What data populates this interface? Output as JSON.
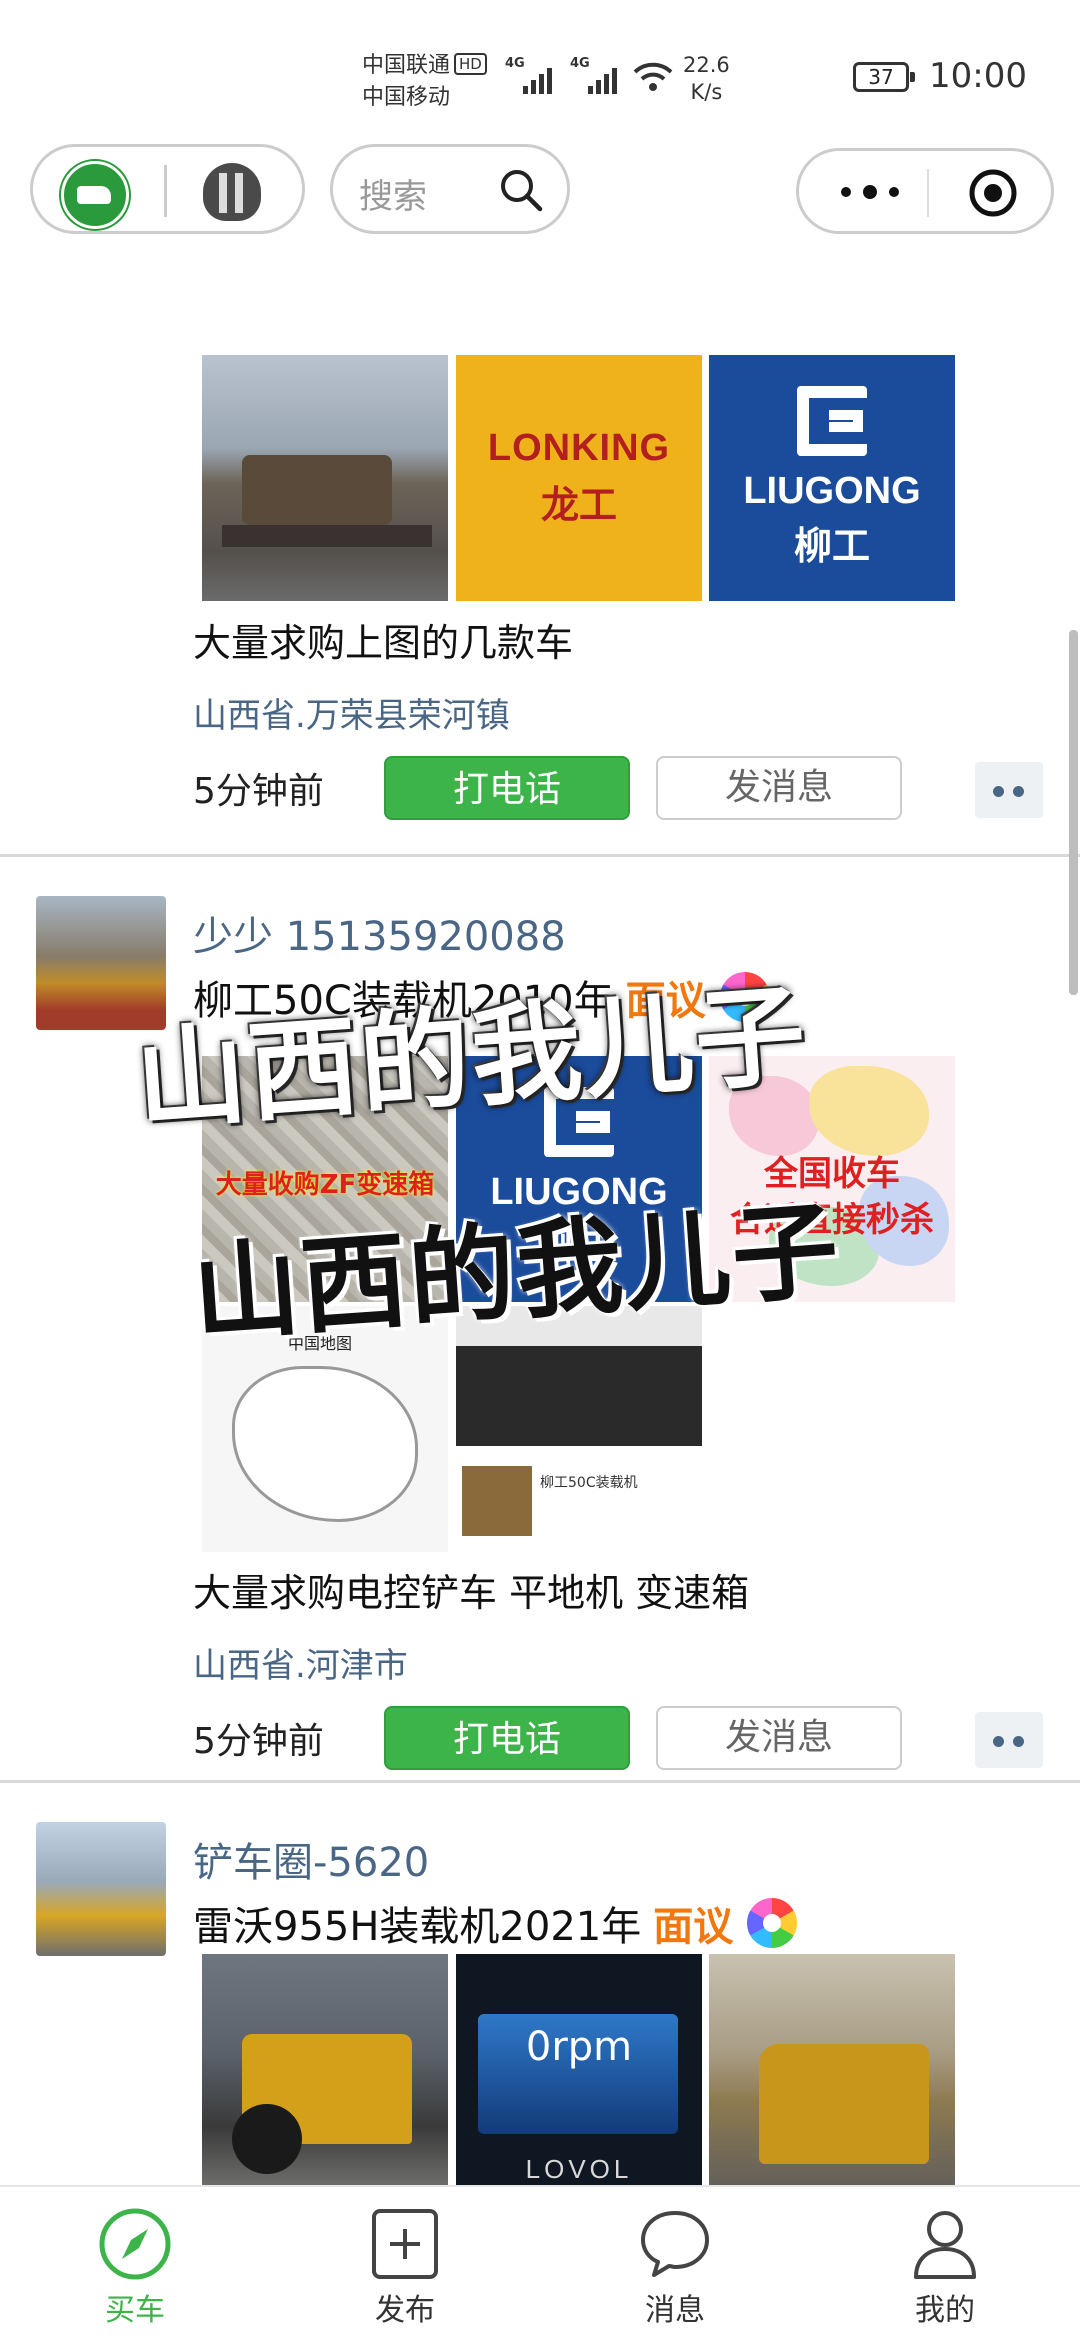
{
  "status_bar": {
    "carrier1": "中国联通",
    "hd": "HD",
    "carrier2": "中国移动",
    "net_type_1": "4G",
    "net_type_2": "4G",
    "speed_value": "22.6",
    "speed_unit": "K/s",
    "battery": "37",
    "time": "10:00"
  },
  "top_nav": {
    "search_placeholder": "搜索"
  },
  "colors": {
    "accent_green": "#3db44a",
    "price_orange": "#f0780f",
    "link_blue": "#4a6685"
  },
  "feed": {
    "card1": {
      "lonking_en": "LONKING",
      "lonking_cn": "龙工",
      "liugong_en": "LIUGONG",
      "liugong_cn": "柳工",
      "description": "大量求购上图的几款车",
      "location": "山西省.万荣县荣河镇",
      "time_ago": "5分钟前",
      "call_label": "打电话",
      "message_label": "发消息"
    },
    "card2": {
      "seller": "少少 15135920088",
      "title": "柳工50C装载机2010年",
      "price": "面议",
      "gravel_caption": "大量收购ZF变速箱",
      "liugong_en": "LIUGONG",
      "liugong_cn": "柳工",
      "map_caption_1": "全国收车",
      "map_caption_2": "合适直接秒杀",
      "china_map_title": "中国地图",
      "screens_text": "柳工50C装载机",
      "watermark_top": "山西的我儿子",
      "watermark_bottom": "山西的我儿子",
      "description": "大量求购电控铲车 平地机 变速箱",
      "location": "山西省.河津市",
      "time_ago": "5分钟前",
      "call_label": "打电话",
      "message_label": "发消息"
    },
    "card3": {
      "seller": "铲车圈-5620",
      "title": "雷沃955H装载机2021年",
      "price": "面议",
      "dash_rpm": "0rpm",
      "dash_brand": "LOVOL"
    }
  },
  "tab_bar": {
    "buy_label": "买车",
    "publish_label": "发布",
    "messages_label": "消息",
    "mine_label": "我的"
  }
}
